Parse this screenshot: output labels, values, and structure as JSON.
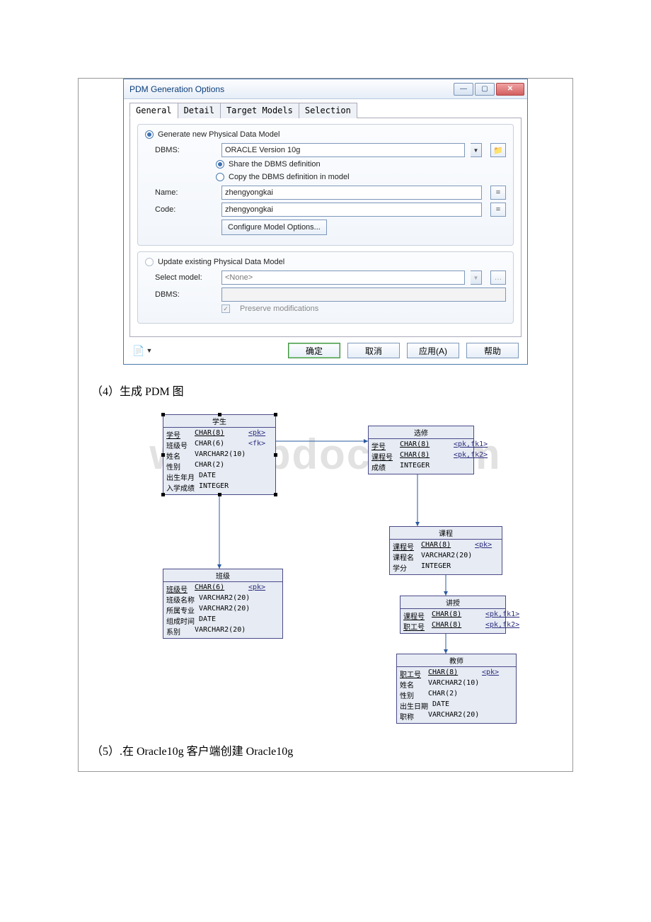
{
  "dialog": {
    "title": "PDM Generation Options",
    "tabs": [
      "General",
      "Detail",
      "Target Models",
      "Selection"
    ],
    "radioGenerate": "Generate new Physical Data Model",
    "dbmsLabel": "DBMS:",
    "dbmsValue": "ORACLE Version 10g",
    "radioShare": "Share the DBMS definition",
    "radioCopy": "Copy the DBMS definition in model",
    "nameLabel": "Name:",
    "nameValue": "zhengyongkai",
    "codeLabel": "Code:",
    "codeValue": "zhengyongkai",
    "configureBtn": "Configure Model Options...",
    "radioUpdate": "Update existing Physical Data Model",
    "selectModelLabel": "Select model:",
    "selectModelValue": "<None>",
    "dbms2Label": "DBMS:",
    "preserve": "Preserve modifications",
    "buttons": {
      "ok": "确定",
      "cancel": "取消",
      "apply": "应用(A)",
      "help": "帮助"
    }
  },
  "captions": {
    "step4": "（4）生成 PDM 图",
    "step5": "（5）.在 Oracle10g 客户端创建 Oracle10g"
  },
  "watermark": "www.bdocx.com",
  "entities": {
    "student": {
      "title": "学生",
      "rows": [
        [
          "学号",
          "CHAR(8)",
          "<pk>"
        ],
        [
          "班级号",
          "CHAR(6)",
          "<fk>"
        ],
        [
          "姓名",
          "VARCHAR2(10)",
          ""
        ],
        [
          "性别",
          "CHAR(2)",
          ""
        ],
        [
          "出生年月",
          "DATE",
          ""
        ],
        [
          "入学成绩",
          "INTEGER",
          ""
        ]
      ]
    },
    "xuanxiu": {
      "title": "选修",
      "rows": [
        [
          "学号",
          "CHAR(8)",
          "<pk,fk1>"
        ],
        [
          "课程号",
          "CHAR(8)",
          "<pk,fk2>"
        ],
        [
          "成绩",
          "INTEGER",
          ""
        ]
      ]
    },
    "course": {
      "title": "课程",
      "rows": [
        [
          "课程号",
          "CHAR(8)",
          "<pk>"
        ],
        [
          "课程名",
          "VARCHAR2(20)",
          ""
        ],
        [
          "学分",
          "INTEGER",
          ""
        ]
      ]
    },
    "banji": {
      "title": "班级",
      "rows": [
        [
          "班级号",
          "CHAR(6)",
          "<pk>"
        ],
        [
          "班级名称",
          "VARCHAR2(20)",
          ""
        ],
        [
          "所属专业",
          "VARCHAR2(20)",
          ""
        ],
        [
          "组成时间",
          "DATE",
          ""
        ],
        [
          "系别",
          "VARCHAR2(20)",
          ""
        ]
      ]
    },
    "jiangshou": {
      "title": "讲授",
      "rows": [
        [
          "课程号",
          "CHAR(8)",
          "<pk,fk1>"
        ],
        [
          "职工号",
          "CHAR(8)",
          "<pk,fk2>"
        ]
      ]
    },
    "teacher": {
      "title": "教师",
      "rows": [
        [
          "职工号",
          "CHAR(8)",
          "<pk>"
        ],
        [
          "姓名",
          "VARCHAR2(10)",
          ""
        ],
        [
          "性别",
          "CHAR(2)",
          ""
        ],
        [
          "出生日期",
          "DATE",
          ""
        ],
        [
          "职称",
          "VARCHAR2(20)",
          ""
        ]
      ]
    }
  }
}
